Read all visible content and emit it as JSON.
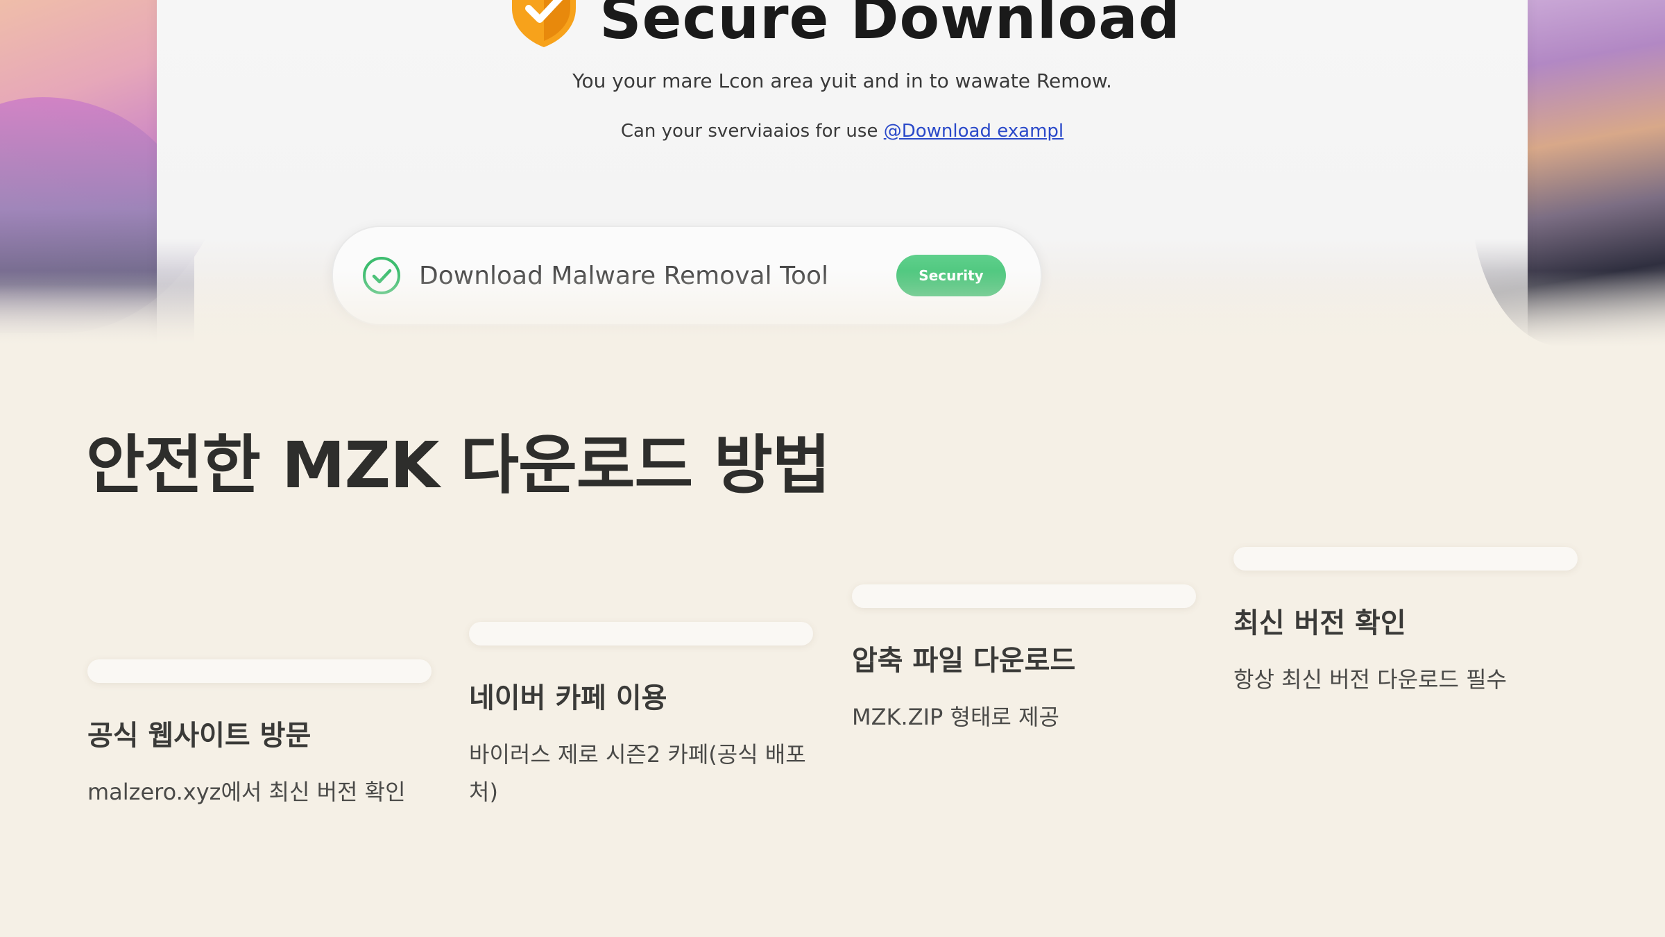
{
  "hero": {
    "headline": "Secure Download",
    "subtitle": "You your mare Lcon area yuit and in to wawate Remow.",
    "subline_prefix": "Can your sverviaaios for use",
    "subline_link": "@Download exampl",
    "download_bar": {
      "label": "Download Malware Removal Tool",
      "badge": "Security",
      "icon": "check-circle-icon"
    },
    "shield_icon": "shield-check-icon",
    "colors": {
      "shield": "#f7a21b",
      "check_green": "#3dbd6f",
      "link": "#2a49c9"
    }
  },
  "main": {
    "title": "안전한 MZK 다운로드 방법",
    "steps": [
      {
        "title": "공식 웹사이트 방문",
        "desc": "malzero.xyz에서 최신 버전 확인"
      },
      {
        "title": "네이버 카페 이용",
        "desc": "바이러스 제로 시즌2 카페(공식 배포처)"
      },
      {
        "title": "압축 파일 다운로드",
        "desc": "MZK.ZIP 형태로 제공"
      },
      {
        "title": "최신 버전 확인",
        "desc": "항상 최신 버전 다운로드 필수"
      }
    ]
  },
  "colors": {
    "background": "#f5f0e6",
    "text": "#2e2e2c"
  }
}
